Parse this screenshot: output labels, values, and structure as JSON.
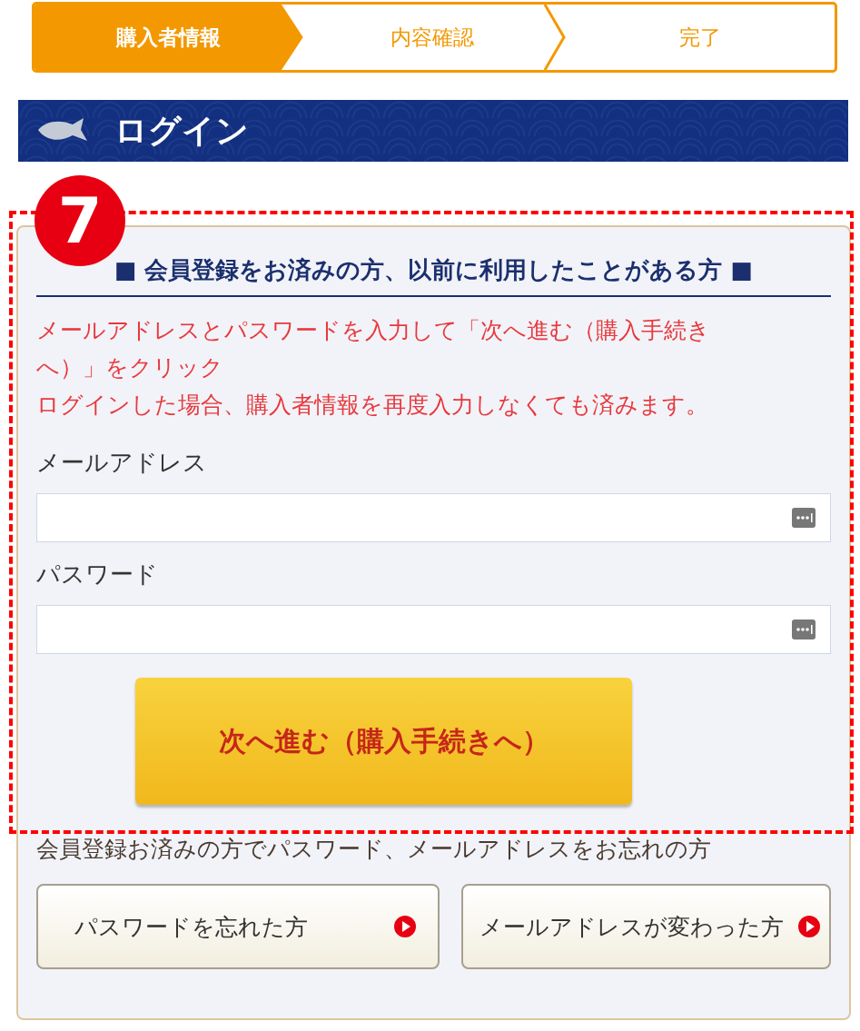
{
  "steps": [
    {
      "label": "購入者情報",
      "selected": true
    },
    {
      "label": "内容確認",
      "selected": false
    },
    {
      "label": "完了",
      "selected": false
    }
  ],
  "banner": {
    "title": "ログイン"
  },
  "annotation": {
    "number": "7"
  },
  "login": {
    "heading": "■ 会員登録をお済みの方、以前に利用したことがある方 ■",
    "notes": [
      "メールアドレスとパスワードを入力して「次へ進む（購入手続きへ）」をクリック",
      "ログインした場合、購入者情報を再度入力しなくても済みます。"
    ],
    "fields": [
      {
        "label": "メールアドレス"
      },
      {
        "label": "パスワード"
      }
    ],
    "submit": "次へ進む（購入手続きへ）"
  },
  "forgot": {
    "text": "会員登録お済みの方でパスワード、メールアドレスをお忘れの方",
    "buttons": [
      "パスワードを忘れた方",
      "メールアドレスが変わった方"
    ]
  }
}
